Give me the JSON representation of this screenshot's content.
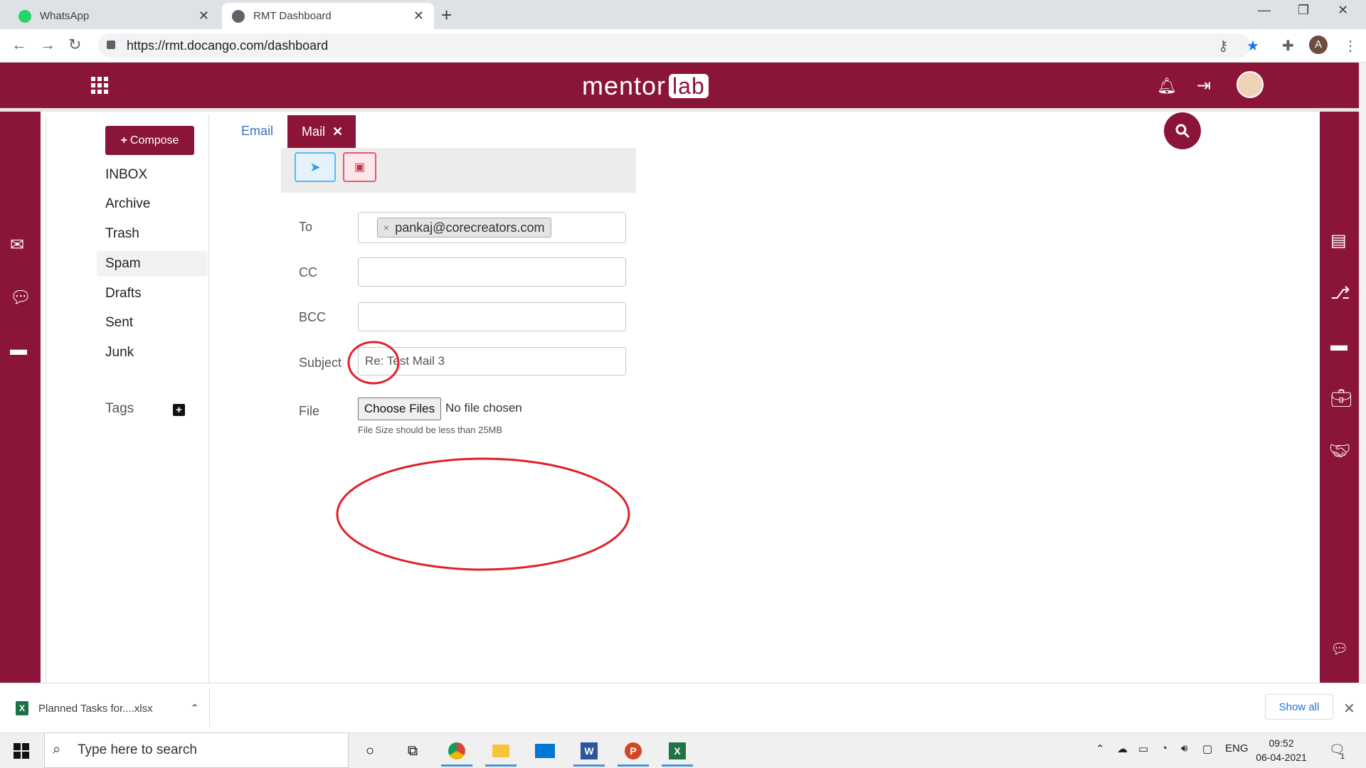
{
  "browser": {
    "tabs": [
      {
        "title": "WhatsApp",
        "active": false
      },
      {
        "title": "RMT Dashboard",
        "active": true
      }
    ],
    "url": "https://rmt.docango.com/dashboard",
    "profile_initial": "A"
  },
  "header": {
    "logo_text": "mentor",
    "logo_badge": "lab"
  },
  "sidebar": {
    "compose_label": "Compose",
    "folders": [
      {
        "label": "INBOX",
        "selected": false
      },
      {
        "label": "Archive",
        "selected": false
      },
      {
        "label": "Trash",
        "selected": false
      },
      {
        "label": "Spam",
        "selected": true
      },
      {
        "label": "Drafts",
        "selected": false
      },
      {
        "label": "Sent",
        "selected": false
      },
      {
        "label": "Junk",
        "selected": false
      }
    ],
    "tags_label": "Tags"
  },
  "tabs": {
    "email_label": "Email",
    "mail_label": "Mail"
  },
  "form": {
    "to_label": "To",
    "to_recipients": [
      "pankaj@corecreators.com"
    ],
    "cc_label": "CC",
    "cc_value": "",
    "bcc_label": "BCC",
    "bcc_value": "",
    "subject_label": "Subject",
    "subject_value": "Re: Test Mail 3",
    "file_label": "File",
    "file_button": "Choose Files",
    "file_status": "No file chosen",
    "file_hint": "File Size should be less than 25MB"
  },
  "downloads": {
    "item": "Planned Tasks for....xlsx",
    "show_all": "Show all"
  },
  "taskbar": {
    "search_placeholder": "Type here to search",
    "language": "ENG",
    "time": "09:52",
    "date": "06-04-2021",
    "notification_count": "1"
  },
  "colors": {
    "brand": "#8b1538",
    "annotation": "#e0202a"
  }
}
